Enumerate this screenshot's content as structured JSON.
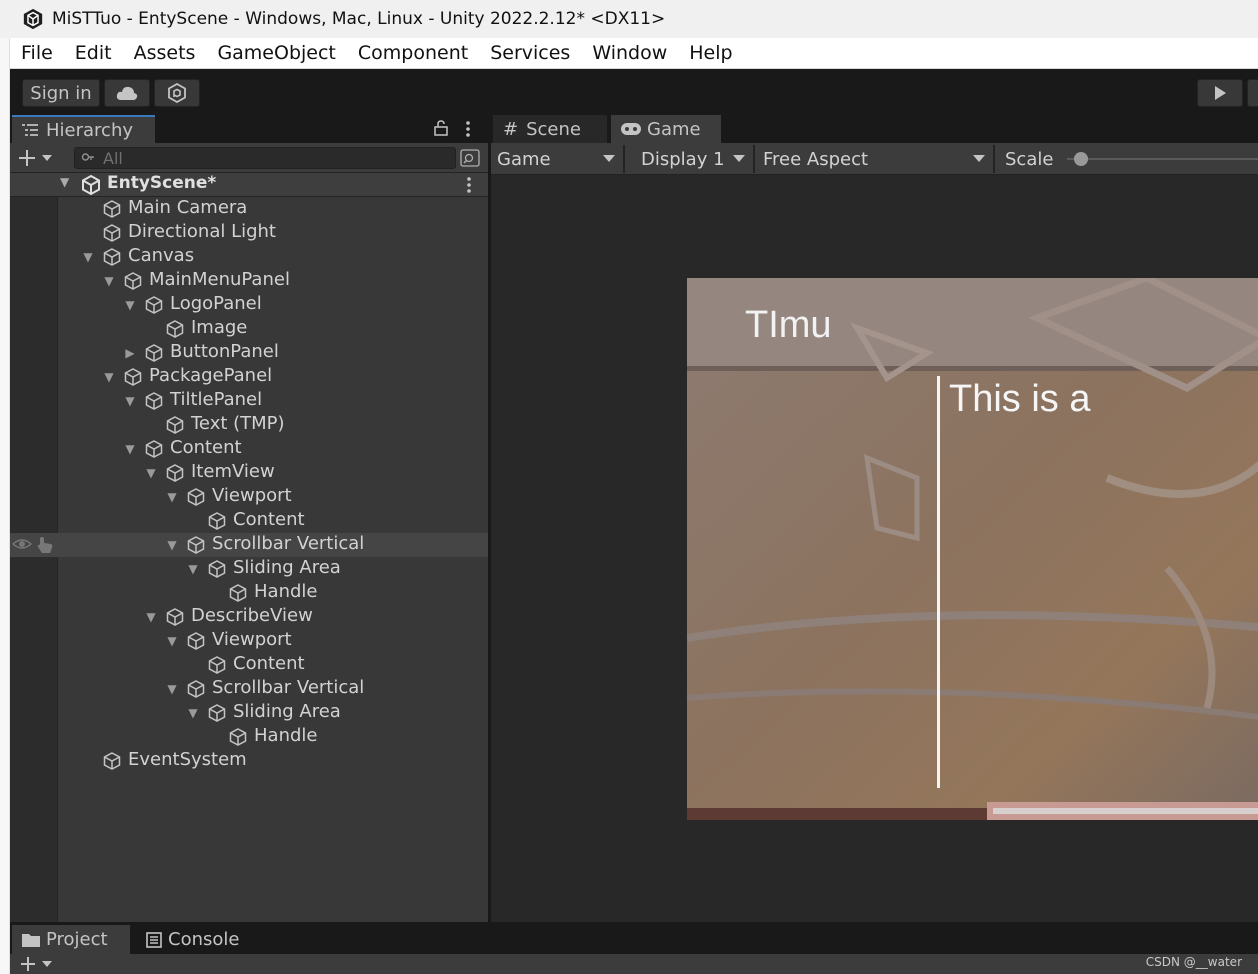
{
  "window": {
    "title": "MiSTTuo - EntyScene - Windows, Mac, Linux - Unity 2022.2.12* <DX11>"
  },
  "menu": [
    "File",
    "Edit",
    "Assets",
    "GameObject",
    "Component",
    "Services",
    "Window",
    "Help"
  ],
  "toolbar": {
    "sign_in": "Sign in"
  },
  "hierarchy": {
    "tab_label": "Hierarchy",
    "search_placeholder": "All",
    "scene_name": "EntyScene*",
    "items": [
      {
        "label": "Main Camera"
      },
      {
        "label": "Directional Light"
      },
      {
        "label": "Canvas"
      },
      {
        "label": "MainMenuPanel"
      },
      {
        "label": "LogoPanel"
      },
      {
        "label": "Image"
      },
      {
        "label": "ButtonPanel"
      },
      {
        "label": "PackagePanel"
      },
      {
        "label": "TiltlePanel"
      },
      {
        "label": "Text (TMP)"
      },
      {
        "label": "Content"
      },
      {
        "label": "ItemView"
      },
      {
        "label": "Viewport"
      },
      {
        "label": "Content"
      },
      {
        "label": "Scrollbar Vertical"
      },
      {
        "label": "Sliding Area"
      },
      {
        "label": "Handle"
      },
      {
        "label": "DescribeView"
      },
      {
        "label": "Viewport"
      },
      {
        "label": "Content"
      },
      {
        "label": "Scrollbar Vertical"
      },
      {
        "label": "Sliding Area"
      },
      {
        "label": "Handle"
      },
      {
        "label": "EventSystem"
      }
    ]
  },
  "game_panel": {
    "tabs": [
      {
        "label": "Scene"
      },
      {
        "label": "Game"
      }
    ],
    "mode": "Game",
    "display": "Display 1",
    "aspect": "Free Aspect",
    "scale_label": "Scale",
    "game_title_text": "TImu",
    "game_desc_text": "This is a"
  },
  "bottom_tabs": [
    {
      "label": "Project"
    },
    {
      "label": "Console"
    }
  ],
  "watermark": "CSDN @__water"
}
